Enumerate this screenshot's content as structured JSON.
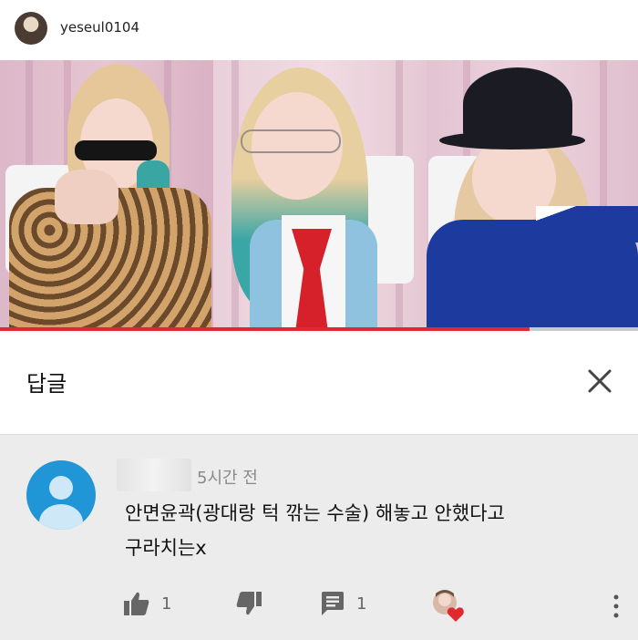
{
  "header": {
    "username": "yeseul0104",
    "avatar_icon": "profile-photo-avatar"
  },
  "video": {
    "progress": 0.83,
    "progress_color": "#e0282e"
  },
  "reply_panel": {
    "title": "답글",
    "close_icon": "close-icon"
  },
  "comment": {
    "avatar_icon": "default-user-avatar",
    "timestamp": "5시간 전",
    "text_line1": "안면윤곽(광대랑 턱 깎는 수술) 해놓고 안했다고",
    "text_line2": "구라치는x",
    "like_count": "1",
    "reply_count": "1",
    "accent_color": "#2196d6"
  },
  "actions": {
    "like_icon": "thumbs-up-icon",
    "dislike_icon": "thumbs-down-icon",
    "reply_icon": "comment-icon",
    "heart_icon": "creator-heart-icon",
    "more_icon": "more-vert-icon"
  }
}
